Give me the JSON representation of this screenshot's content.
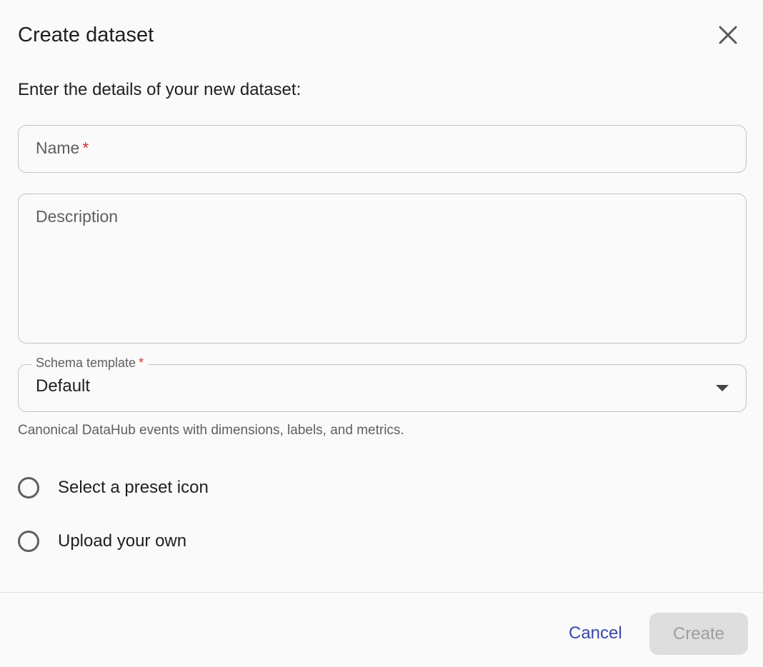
{
  "dialog": {
    "title": "Create dataset",
    "subtitle": "Enter the details of your new dataset:"
  },
  "fields": {
    "name": {
      "placeholder": "Name",
      "required_marker": "*",
      "value": ""
    },
    "description": {
      "placeholder": "Description",
      "value": ""
    },
    "schema_template": {
      "label": "Schema template",
      "required_marker": "*",
      "selected": "Default",
      "helper_text": "Canonical DataHub events with dimensions, labels, and metrics."
    }
  },
  "icon_options": [
    {
      "label": "Select a preset icon",
      "selected": false
    },
    {
      "label": "Upload your own",
      "selected": false
    }
  ],
  "actions": {
    "cancel_label": "Cancel",
    "create_label": "Create",
    "create_enabled": false
  },
  "icons": {
    "close": "close-icon",
    "dropdown": "chevron-down-icon",
    "radio": "radio-unchecked-icon"
  },
  "colors": {
    "accent": "#3949ab",
    "required": "#d32f2f",
    "disabled_bg": "#dedede",
    "disabled_text": "#9e9e9e"
  }
}
